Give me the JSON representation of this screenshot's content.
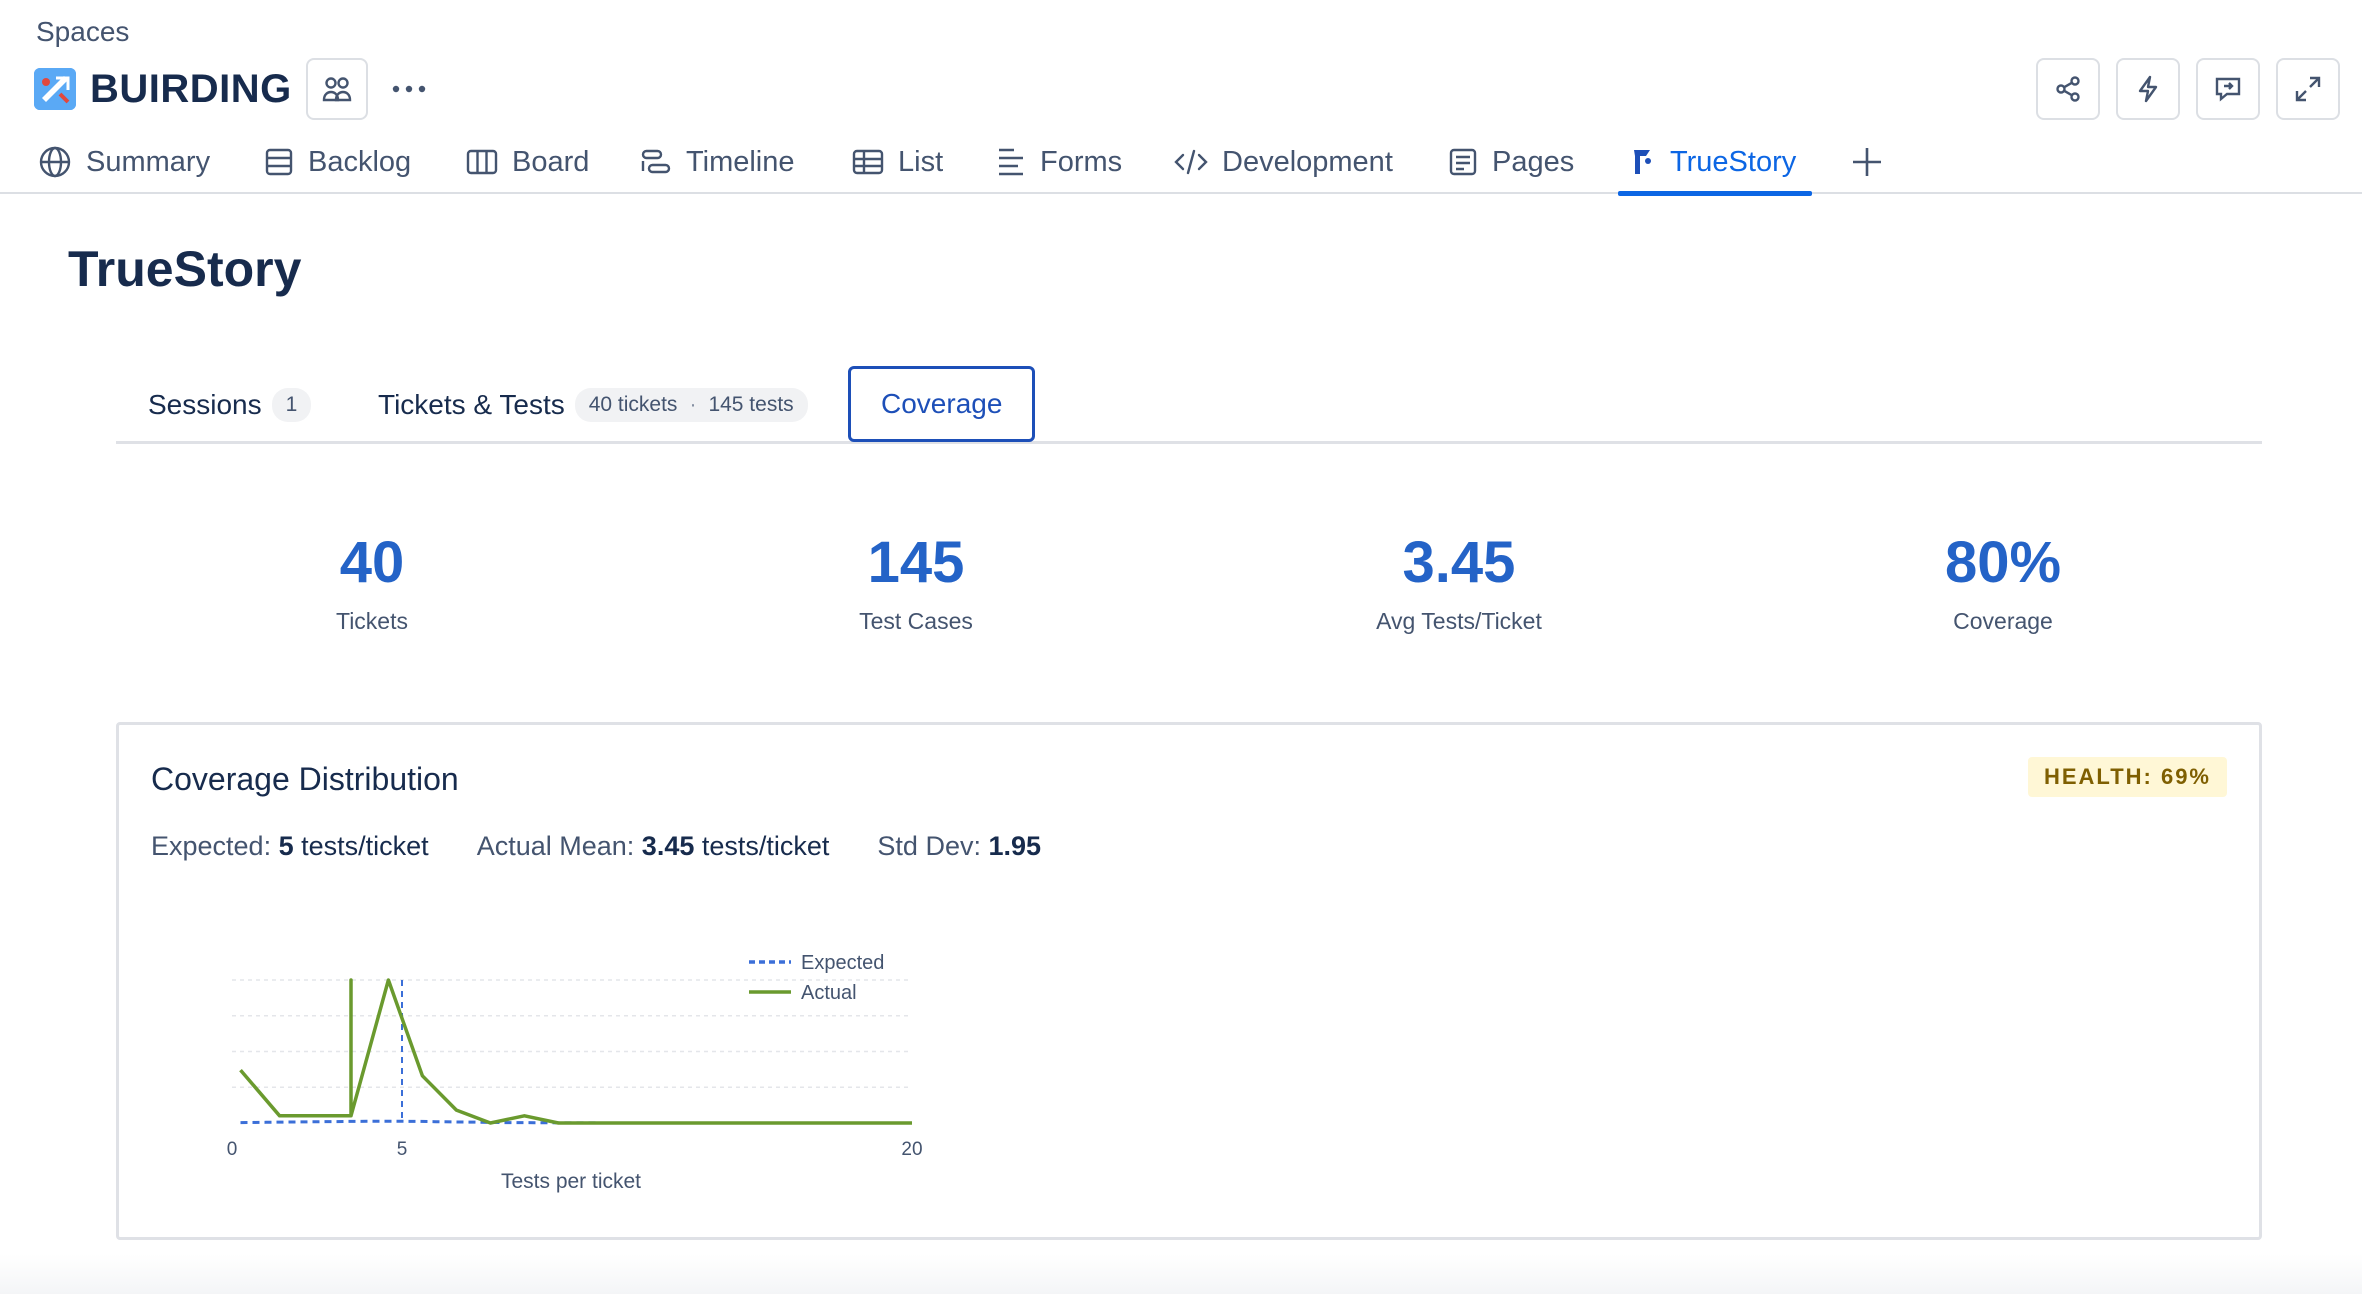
{
  "header": {
    "breadcrumb": "Spaces",
    "space_name": "BUIRDING"
  },
  "nav": {
    "tabs": [
      {
        "label": "Summary",
        "icon": "globe-icon"
      },
      {
        "label": "Backlog",
        "icon": "backlog-icon"
      },
      {
        "label": "Board",
        "icon": "board-icon"
      },
      {
        "label": "Timeline",
        "icon": "timeline-icon"
      },
      {
        "label": "List",
        "icon": "list-icon"
      },
      {
        "label": "Forms",
        "icon": "forms-icon"
      },
      {
        "label": "Development",
        "icon": "code-icon"
      },
      {
        "label": "Pages",
        "icon": "pages-icon"
      },
      {
        "label": "TrueStory",
        "icon": "truestory-icon",
        "active": true
      }
    ],
    "active_color": "#0c66e4"
  },
  "page": {
    "title": "TrueStory"
  },
  "subtabs": {
    "sessions": {
      "label": "Sessions",
      "count": "1"
    },
    "tickets_tests": {
      "label": "Tickets & Tests",
      "tickets": "40 tickets",
      "tests": "145 tests"
    },
    "coverage": {
      "label": "Coverage",
      "selected": true
    }
  },
  "stats": [
    {
      "value": "40",
      "label": "Tickets"
    },
    {
      "value": "145",
      "label": "Test Cases"
    },
    {
      "value": "3.45",
      "label": "Avg Tests/Ticket"
    },
    {
      "value": "80%",
      "label": "Coverage"
    }
  ],
  "card": {
    "title": "Coverage Distribution",
    "health": "HEALTH: 69%",
    "expected_label": "Expected:",
    "expected_value": "5",
    "expected_unit": "tests/ticket",
    "mean_label": "Actual Mean:",
    "mean_value": "3.45",
    "mean_unit": "tests/ticket",
    "std_label": "Std Dev:",
    "std_value": "1.95"
  },
  "chart_data": {
    "type": "line",
    "xlabel": "Tests per ticket",
    "ylabel": "",
    "xlim": [
      0,
      20
    ],
    "ylim": [
      0,
      1
    ],
    "xticks": [
      0,
      5,
      20
    ],
    "grid": true,
    "legend": "top-right",
    "series": [
      {
        "name": "Expected",
        "style": "dashed",
        "color": "#3b6fd8",
        "x": [
          0.25,
          1,
          2,
          3,
          3.5,
          4,
          4.5,
          5,
          5.5,
          6,
          7,
          8,
          9,
          10,
          12,
          14,
          16,
          18,
          20
        ],
        "y": [
          0.003,
          0.005,
          0.008,
          0.01,
          0.011,
          0.012,
          0.012,
          0.012,
          0.011,
          0.009,
          0.006,
          0.003,
          0.002,
          0.001,
          0,
          0,
          0,
          0,
          0
        ]
      },
      {
        "name": "Actual",
        "style": "solid",
        "color": "#6a9a2e",
        "x": [
          0.25,
          1.4,
          3.5,
          3.5,
          3.5,
          4.6,
          5.6,
          6.6,
          7.6,
          8.6,
          9.6,
          20
        ],
        "y": [
          0.37,
          0.05,
          0.05,
          1.0,
          0.05,
          1.0,
          0.33,
          0.09,
          0.0,
          0.05,
          0.0,
          0.0
        ]
      }
    ],
    "expected_marker_x": 5
  }
}
